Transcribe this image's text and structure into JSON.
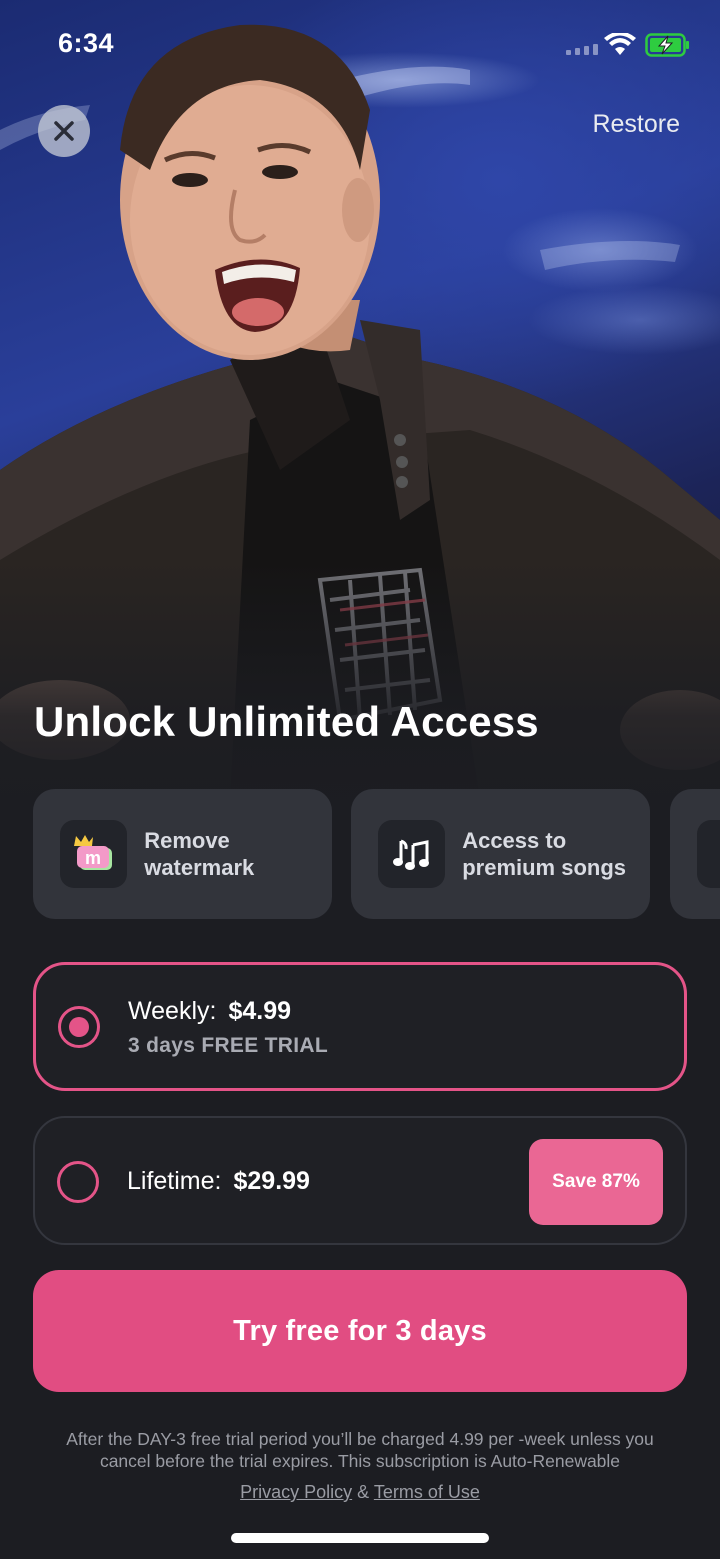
{
  "status_bar": {
    "time": "6:34",
    "signal_icon": "cellular-signal-icon",
    "wifi_icon": "wifi-icon",
    "battery_icon": "battery-charging-icon"
  },
  "header": {
    "close_icon": "close-icon",
    "restore_label": "Restore"
  },
  "hero": {
    "image": "person-photo-on-blue-space-background"
  },
  "headline": "Unlock Unlimited Access",
  "features": [
    {
      "icon": "crown-watermark-icon",
      "label": "Remove watermark"
    },
    {
      "icon": "music-note-icon",
      "label": "Access to premium songs"
    },
    {
      "icon": "feature-icon",
      "label": ""
    }
  ],
  "plans": {
    "weekly": {
      "label": "Weekly:",
      "price": "$4.99",
      "subtitle": "3 days FREE TRIAL",
      "selected": true
    },
    "lifetime": {
      "label": "Lifetime:",
      "price": "$29.99",
      "badge": "Save 87%",
      "selected": false
    }
  },
  "cta_label": "Try free for 3 days",
  "disclaimer": {
    "line1": "After the DAY-3 free trial period you’ll be charged 4.99 per -week unless you",
    "line2": "cancel before the trial expires. This subscription is Auto-Renewable"
  },
  "legal": {
    "privacy": "Privacy Policy",
    "separator": "&",
    "terms": "Terms of Use"
  },
  "colors": {
    "accent": "#e14d82",
    "background": "#1c1d22",
    "card": "#34363e"
  }
}
